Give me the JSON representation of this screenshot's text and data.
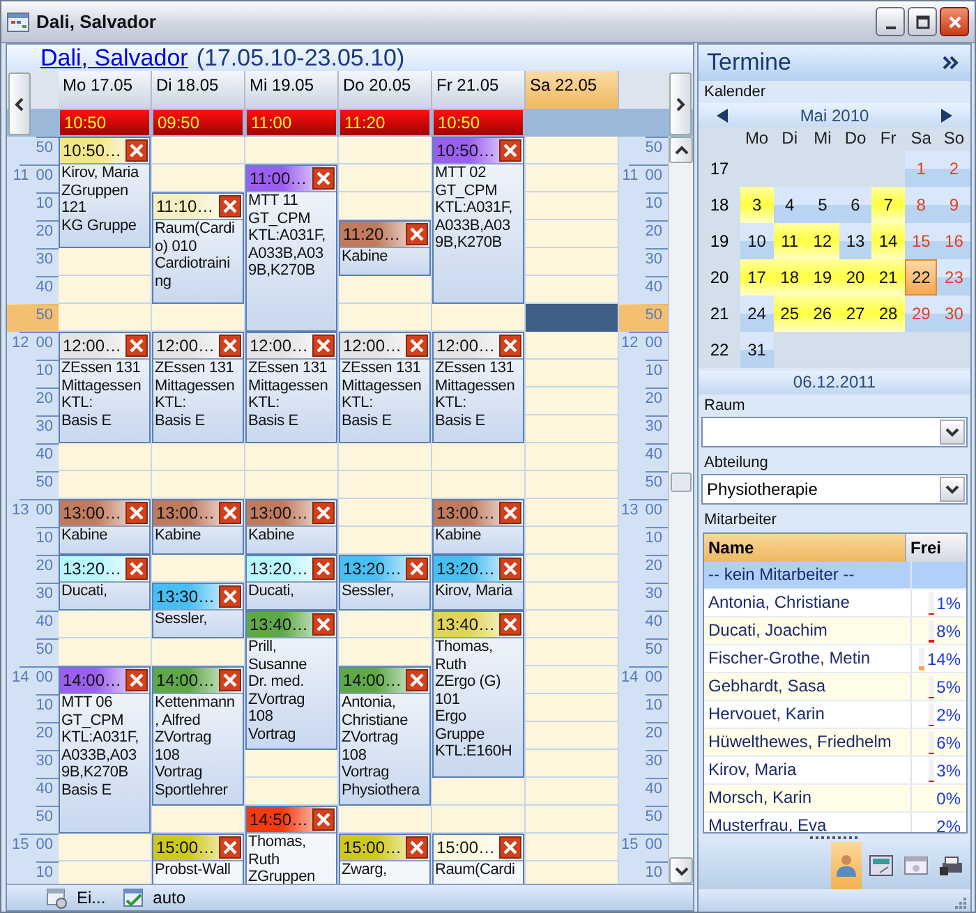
{
  "window": {
    "title": "Dali, Salvador"
  },
  "heading": {
    "name": "Dali, Salvador",
    "range": "(17.05.10-23.05.10)"
  },
  "days": [
    {
      "label": "Mo 17.05",
      "selected": false,
      "first_time": "10:50",
      "events": [
        {
          "time": "10:50…",
          "kind": "forty",
          "color": "#f2e68a",
          "lines": [
            "Kirov, Maria",
            "ZGruppen",
            "121",
            "KG Gruppe"
          ]
        },
        {
          "time": "12:00…",
          "kind": "forty",
          "color": "#e4e4e4",
          "lines": [
            "ZEssen 131",
            "Mittagessen",
            "KTL:",
            "Basis E"
          ]
        },
        {
          "time": "13:00…",
          "kind": "twenty",
          "color": "#c07a5e",
          "lines": [
            "Kabine"
          ]
        },
        {
          "time": "13:20…",
          "kind": "twenty",
          "color": "#b8f6ff",
          "lines": [
            "Ducati,"
          ]
        },
        {
          "time": "14:00…",
          "kind": "sixty",
          "color": "#9b5ff0",
          "lines": [
            "MTT 06",
            "GT_CPM",
            "KTL:A031F,",
            "A033B,A03",
            "9B,K270B",
            "Basis E"
          ]
        }
      ]
    },
    {
      "label": "Di 18.05",
      "selected": false,
      "first_time": "09:50",
      "events": [
        {
          "time": "11:10…",
          "kind": "forty",
          "color": "#f6f0c0",
          "lines": [
            "Raum(Cardi",
            "o) 010",
            "Cardiotraini",
            "ng"
          ]
        },
        {
          "time": "12:00…",
          "kind": "forty",
          "color": "#e4e4e4",
          "lines": [
            "ZEssen 131",
            "Mittagessen",
            "KTL:",
            "Basis E"
          ]
        },
        {
          "time": "13:00…",
          "kind": "twenty",
          "color": "#c07a5e",
          "lines": [
            "Kabine"
          ]
        },
        {
          "time": "13:30…",
          "kind": "twenty",
          "color": "#48bff2",
          "lines": [
            "Sessler,"
          ]
        },
        {
          "time": "14:00…",
          "kind": "fifty",
          "color": "#5ea84a",
          "lines": [
            "Kettenmann",
            ", Alfred",
            "ZVortrag",
            "108",
            "Vortrag",
            "Sportlehrer"
          ]
        },
        {
          "time": "15:00…",
          "kind": "open",
          "color": "#cfc81c",
          "lines": [
            "Probst-Wall"
          ]
        }
      ]
    },
    {
      "label": "Mi 19.05",
      "selected": false,
      "first_time": "11:00",
      "events": [
        {
          "time": "11:00…",
          "kind": "sixty",
          "color": "#9b5ff0",
          "lines": [
            "MTT 11",
            "GT_CPM",
            "KTL:A031F,",
            "A033B,A03",
            "9B,K270B"
          ]
        },
        {
          "time": "12:00…",
          "kind": "forty",
          "color": "#e4e4e4",
          "lines": [
            "ZEssen 131",
            "Mittagessen",
            "KTL:",
            "Basis E"
          ]
        },
        {
          "time": "13:00…",
          "kind": "twenty",
          "color": "#c07a5e",
          "lines": [
            "Kabine"
          ]
        },
        {
          "time": "13:20…",
          "kind": "twenty",
          "color": "#b8f6ff",
          "lines": [
            "Ducati,"
          ]
        },
        {
          "time": "13:40…",
          "kind": "fifty",
          "color": "#5ea84a",
          "lines": [
            "Prill,",
            "Susanne",
            "Dr. med.",
            "ZVortrag",
            "108",
            "Vortrag"
          ]
        },
        {
          "time": "14:50…",
          "kind": "open",
          "color": "#f43a10",
          "lines": [
            "Thomas,",
            "Ruth",
            "ZGruppen"
          ]
        }
      ]
    },
    {
      "label": "Do 20.05",
      "selected": false,
      "first_time": "11:20",
      "events": [
        {
          "time": "11:20…",
          "kind": "twenty",
          "color": "#c07a5e",
          "lines": [
            "Kabine"
          ]
        },
        {
          "time": "12:00…",
          "kind": "forty",
          "color": "#e4e4e4",
          "lines": [
            "ZEssen 131",
            "Mittagessen",
            "KTL:",
            "Basis E"
          ]
        },
        {
          "time": "13:20…",
          "kind": "twenty",
          "color": "#48bff2",
          "lines": [
            "Sessler,"
          ]
        },
        {
          "time": "14:00…",
          "kind": "fifty",
          "color": "#5ea84a",
          "lines": [
            "Antonia,",
            "Christiane",
            "ZVortrag",
            "108",
            "Vortrag",
            "Physiothera"
          ]
        },
        {
          "time": "15:00…",
          "kind": "open",
          "color": "#cfc81c",
          "lines": [
            "Zwarg,"
          ]
        }
      ]
    },
    {
      "label": "Fr 21.05",
      "selected": false,
      "first_time": "10:50",
      "events": [
        {
          "time": "10:50…",
          "kind": "sixty",
          "color": "#9b5ff0",
          "lines": [
            "MTT 02",
            "GT_CPM",
            "KTL:A031F,",
            "A033B,A03",
            "9B,K270B"
          ]
        },
        {
          "time": "12:00…",
          "kind": "forty",
          "color": "#e4e4e4",
          "lines": [
            "ZEssen 131",
            "Mittagessen",
            "KTL:",
            "Basis E"
          ]
        },
        {
          "time": "13:00…",
          "kind": "twenty",
          "color": "#c07a5e",
          "lines": [
            "Kabine"
          ]
        },
        {
          "time": "13:20…",
          "kind": "twenty",
          "color": "#48bff2",
          "lines": [
            "Kirov, Maria"
          ]
        },
        {
          "time": "13:40…",
          "kind": "sixty",
          "color": "#e2d45a",
          "lines": [
            "Thomas,",
            "Ruth",
            "ZErgo (G)",
            "101",
            "Ergo",
            "Gruppe",
            "KTL:E160H"
          ]
        },
        {
          "time": "15:00…",
          "kind": "open",
          "color": "#fbf8dc",
          "lines": [
            "Raum(Cardi"
          ]
        }
      ]
    },
    {
      "label": "Sa 22.05",
      "selected": true
    }
  ],
  "time_labels_left": [
    {
      "label": "50",
      "kind": "minute",
      "current": false
    },
    {
      "label": "11 00",
      "kind": "hour",
      "current": false
    },
    {
      "label": "10",
      "kind": "minute",
      "current": false
    },
    {
      "label": "20",
      "kind": "minute",
      "current": false
    },
    {
      "label": "30",
      "kind": "minute",
      "current": false
    },
    {
      "label": "40",
      "kind": "minute",
      "current": false
    },
    {
      "label": "50",
      "kind": "minute",
      "current": true
    },
    {
      "label": "12 00",
      "kind": "hour",
      "current": false
    },
    {
      "label": "10",
      "kind": "minute",
      "current": false
    },
    {
      "label": "20",
      "kind": "minute",
      "current": false
    },
    {
      "label": "30",
      "kind": "minute",
      "current": false
    },
    {
      "label": "40",
      "kind": "minute",
      "current": false
    },
    {
      "label": "50",
      "kind": "minute",
      "current": false
    },
    {
      "label": "13 00",
      "kind": "hour",
      "current": false
    },
    {
      "label": "10",
      "kind": "minute",
      "current": false
    },
    {
      "label": "20",
      "kind": "minute",
      "current": false
    },
    {
      "label": "30",
      "kind": "minute",
      "current": false
    },
    {
      "label": "40",
      "kind": "minute",
      "current": false
    },
    {
      "label": "50",
      "kind": "minute",
      "current": false
    },
    {
      "label": "14 00",
      "kind": "hour",
      "current": false
    },
    {
      "label": "10",
      "kind": "minute",
      "current": false
    },
    {
      "label": "20",
      "kind": "minute",
      "current": false
    },
    {
      "label": "30",
      "kind": "minute",
      "current": false
    },
    {
      "label": "40",
      "kind": "minute",
      "current": false
    },
    {
      "label": "50",
      "kind": "minute",
      "current": false
    },
    {
      "label": "15 00",
      "kind": "hour",
      "current": false
    },
    {
      "label": "10",
      "kind": "minute",
      "current": false
    }
  ],
  "time_labels_right": [
    {
      "label": "50",
      "kind": "minute",
      "current": false
    },
    {
      "label": "11 00",
      "kind": "hour",
      "current": false
    },
    {
      "label": "10",
      "kind": "minute",
      "current": false
    },
    {
      "label": "20",
      "kind": "minute",
      "current": false
    },
    {
      "label": "30",
      "kind": "minute",
      "current": false
    },
    {
      "label": "40",
      "kind": "minute",
      "current": false
    },
    {
      "label": "50",
      "kind": "minute",
      "current": true
    },
    {
      "label": "12 00",
      "kind": "hour",
      "current": false
    },
    {
      "label": "10",
      "kind": "minute",
      "current": false
    },
    {
      "label": "20",
      "kind": "minute",
      "current": false
    },
    {
      "label": "30",
      "kind": "minute",
      "current": false
    },
    {
      "label": "40",
      "kind": "minute",
      "current": false
    },
    {
      "label": "50",
      "kind": "minute",
      "current": false
    },
    {
      "label": "13 00",
      "kind": "hour",
      "current": false
    },
    {
      "label": "10",
      "kind": "minute",
      "current": false
    },
    {
      "label": "20",
      "kind": "minute",
      "current": false
    },
    {
      "label": "30",
      "kind": "minute",
      "current": false
    },
    {
      "label": "40",
      "kind": "minute",
      "current": false
    },
    {
      "label": "50",
      "kind": "minute",
      "current": false
    },
    {
      "label": "14 00",
      "kind": "hour",
      "current": false
    },
    {
      "label": "10",
      "kind": "minute",
      "current": false
    },
    {
      "label": "20",
      "kind": "minute",
      "current": false
    },
    {
      "label": "30",
      "kind": "minute",
      "current": false
    },
    {
      "label": "40",
      "kind": "minute",
      "current": false
    },
    {
      "label": "50",
      "kind": "minute",
      "current": false
    },
    {
      "label": "15 00",
      "kind": "hour",
      "current": false
    },
    {
      "label": "10",
      "kind": "minute",
      "current": false
    }
  ],
  "status_bar": [
    "Ei...",
    "auto"
  ],
  "panel": {
    "title": "Termine",
    "calendar_label": "Kalender",
    "month": "Mai 2010",
    "weekdays": [
      "Mo",
      "Di",
      "Mi",
      "Do",
      "Fr",
      "Sa",
      "So"
    ],
    "weeks": [
      {
        "week": "17",
        "days": [
          {
            "day": "1",
            "marked": false,
            "selected": false
          },
          {
            "day": "2",
            "marked": false,
            "selected": false
          }
        ]
      },
      {
        "week": "18",
        "days": [
          {
            "day": "3",
            "marked": true,
            "selected": false
          },
          {
            "day": "4",
            "marked": false,
            "selected": false
          },
          {
            "day": "5",
            "marked": false,
            "selected": false
          },
          {
            "day": "6",
            "marked": false,
            "selected": false
          },
          {
            "day": "7",
            "marked": true,
            "selected": false
          },
          {
            "day": "8",
            "marked": false,
            "selected": false
          },
          {
            "day": "9",
            "marked": false,
            "selected": false
          }
        ]
      },
      {
        "week": "19",
        "days": [
          {
            "day": "10",
            "marked": false,
            "selected": false
          },
          {
            "day": "11",
            "marked": true,
            "selected": false
          },
          {
            "day": "12",
            "marked": true,
            "selected": false
          },
          {
            "day": "13",
            "marked": false,
            "selected": false
          },
          {
            "day": "14",
            "marked": true,
            "selected": false
          },
          {
            "day": "15",
            "marked": false,
            "selected": false
          },
          {
            "day": "16",
            "marked": false,
            "selected": false
          }
        ]
      },
      {
        "week": "20",
        "days": [
          {
            "day": "17",
            "marked": true,
            "selected": false
          },
          {
            "day": "18",
            "marked": true,
            "selected": false
          },
          {
            "day": "19",
            "marked": true,
            "selected": false
          },
          {
            "day": "20",
            "marked": true,
            "selected": false
          },
          {
            "day": "21",
            "marked": true,
            "selected": false
          },
          {
            "day": "22",
            "marked": false,
            "selected": true
          },
          {
            "day": "23",
            "marked": false,
            "selected": false
          }
        ]
      },
      {
        "week": "21",
        "days": [
          {
            "day": "24",
            "marked": false,
            "selected": false
          },
          {
            "day": "25",
            "marked": true,
            "selected": false
          },
          {
            "day": "26",
            "marked": true,
            "selected": false
          },
          {
            "day": "27",
            "marked": true,
            "selected": false
          },
          {
            "day": "28",
            "marked": true,
            "selected": false
          },
          {
            "day": "29",
            "marked": false,
            "selected": false
          },
          {
            "day": "30",
            "marked": false,
            "selected": false
          }
        ]
      },
      {
        "week": "22",
        "days": [
          {
            "day": "31",
            "marked": false,
            "selected": false
          }
        ]
      }
    ],
    "today": "06.12.2011",
    "room_label": "Raum",
    "department_label": "Abteilung",
    "department": "Physiotherapie",
    "staff_label": "Mitarbeiter",
    "staff_columns": [
      "Name",
      "Frei"
    ],
    "staff": [
      {
        "name": "-- kein Mitarbeiter --",
        "selected": true
      },
      {
        "name": "Antonia, Christiane",
        "free": "1%",
        "level": 0.01,
        "selected": false
      },
      {
        "name": "Ducati, Joachim",
        "free": "8%",
        "level": 0.08,
        "selected": false
      },
      {
        "name": "Fischer-Grothe, Metin",
        "free": "14%",
        "level": 0.14,
        "selected": false
      },
      {
        "name": "Gebhardt, Sasa",
        "free": "5%",
        "level": 0.05,
        "selected": false
      },
      {
        "name": "Hervouet, Karin",
        "free": "2%",
        "level": 0.02,
        "selected": false
      },
      {
        "name": "Hüwelthewes, Friedhelm",
        "free": "6%",
        "level": 0.06,
        "selected": false
      },
      {
        "name": "Kirov, Maria",
        "free": "3%",
        "level": 0.03,
        "selected": false
      },
      {
        "name": "Morsch, Karin",
        "free": "0%",
        "selected": false
      },
      {
        "name": "Musterfrau, Eva",
        "free": "2%",
        "selected": false
      }
    ],
    "toolbar": [
      {
        "selected": true
      },
      {
        "selected": false
      },
      {
        "selected": false
      },
      {
        "selected": false
      }
    ]
  }
}
